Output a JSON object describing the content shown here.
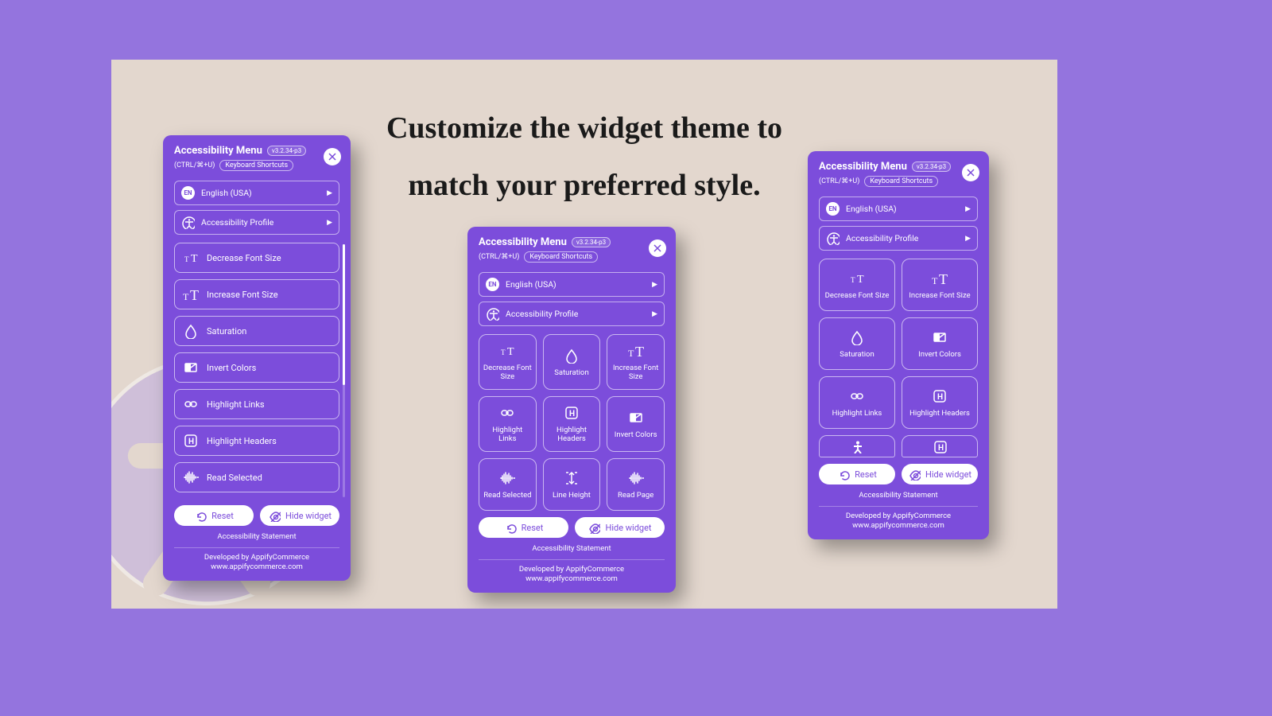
{
  "heading_line1": "Customize the widget theme to",
  "heading_line2": "match your preferred style.",
  "version": "v3.2.34-p3",
  "title": "Accessibility Menu",
  "shortcut_hint": "(CTRL/⌘+U)",
  "kb_label": "Keyboard Shortcuts",
  "lang_chip": "EN",
  "lang_label": "English (USA)",
  "profile_label": "Accessibility Profile",
  "reset_label": "Reset",
  "hide_label": "Hide widget",
  "statement": "Accessibility Statement",
  "dev_line1": "Developed by AppifyCommerce",
  "dev_line2": "www.appifycommerce.com",
  "panel1_items": [
    {
      "label": "Decrease Font Size",
      "icon": "font-decrease"
    },
    {
      "label": "Increase Font Size",
      "icon": "font-increase"
    },
    {
      "label": "Saturation",
      "icon": "droplet"
    },
    {
      "label": "Invert Colors",
      "icon": "invert"
    },
    {
      "label": "Highlight Links",
      "icon": "link"
    },
    {
      "label": "Highlight Headers",
      "icon": "h-box"
    },
    {
      "label": "Read Selected",
      "icon": "wave"
    }
  ],
  "panel2_items": [
    {
      "label": "Decrease Font Size",
      "icon": "font-decrease"
    },
    {
      "label": "Saturation",
      "icon": "droplet"
    },
    {
      "label": "Increase Font Size",
      "icon": "font-increase"
    },
    {
      "label": "Highlight Links",
      "icon": "link"
    },
    {
      "label": "Highlight Headers",
      "icon": "h-box"
    },
    {
      "label": "Invert Colors",
      "icon": "invert"
    },
    {
      "label": "Read Selected",
      "icon": "wave"
    },
    {
      "label": "Line Height",
      "icon": "line-height"
    },
    {
      "label": "Read Page",
      "icon": "wave"
    }
  ],
  "panel3_items": [
    {
      "label": "Decrease Font Size",
      "icon": "font-decrease"
    },
    {
      "label": "Increase Font Size",
      "icon": "font-increase"
    },
    {
      "label": "Saturation",
      "icon": "droplet"
    },
    {
      "label": "Invert Colors",
      "icon": "invert"
    },
    {
      "label": "Highlight Links",
      "icon": "link"
    },
    {
      "label": "Highlight Headers",
      "icon": "h-box"
    }
  ],
  "panel3_half": [
    {
      "icon": "person"
    },
    {
      "icon": "h-box"
    }
  ]
}
